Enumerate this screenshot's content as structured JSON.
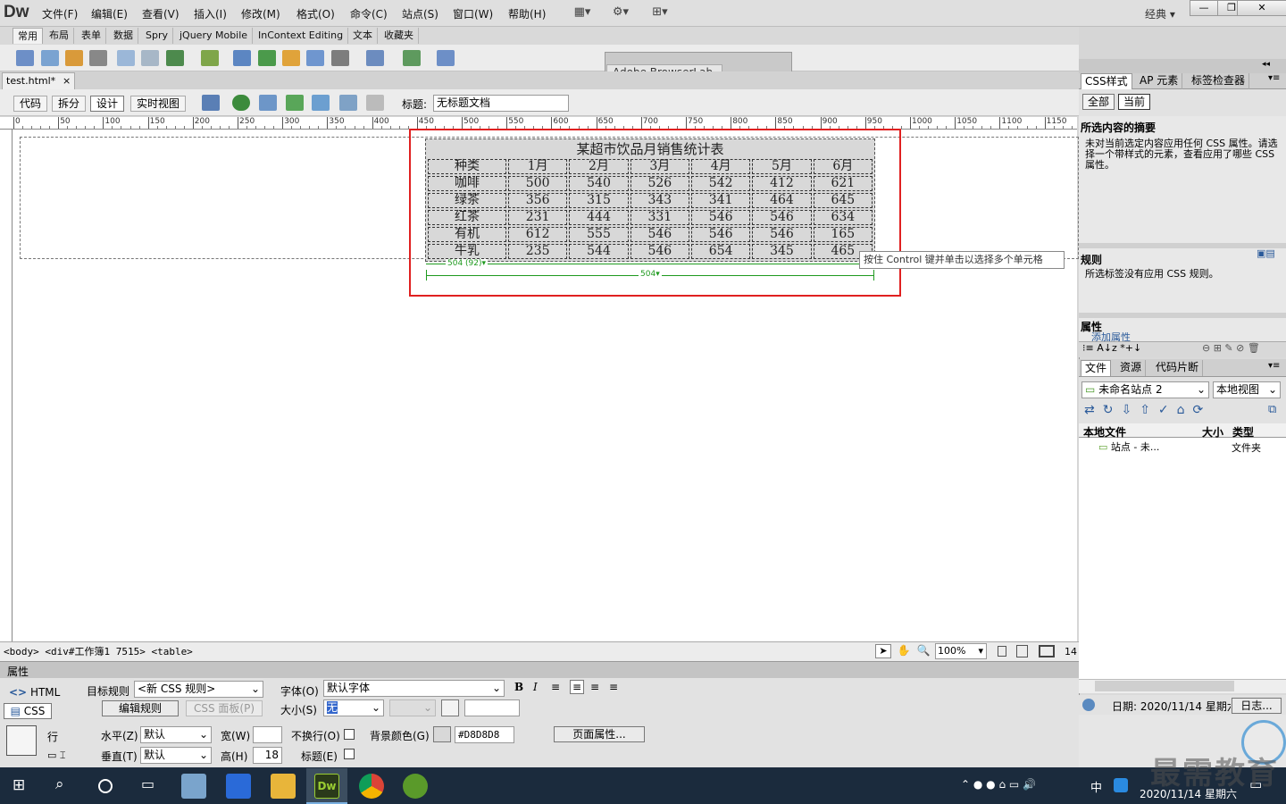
{
  "app": {
    "logo": "Dw",
    "layout_mode": "经典"
  },
  "menu": [
    "文件(F)",
    "编辑(E)",
    "查看(V)",
    "插入(I)",
    "修改(M)",
    "格式(O)",
    "命令(C)",
    "站点(S)",
    "窗口(W)",
    "帮助(H)"
  ],
  "insert_tabs": [
    "常用",
    "布局",
    "表单",
    "数据",
    "Spry",
    "jQuery Mobile",
    "InContext Editing",
    "文本",
    "收藏夹"
  ],
  "floating_panel": {
    "title": "Adobe BrowserLab"
  },
  "document": {
    "tab": "test.html*",
    "close": "×"
  },
  "view_buttons": [
    "代码",
    "拆分",
    "设计",
    "实时视图"
  ],
  "title_label": "标题:",
  "title_value": "无标题文档",
  "ruler": [
    "0",
    "50",
    "100",
    "150",
    "200",
    "250",
    "300",
    "350",
    "400",
    "450",
    "500",
    "550",
    "600",
    "650",
    "700",
    "750",
    "800",
    "850",
    "900",
    "950",
    "1000",
    "1050",
    "1100",
    "1150"
  ],
  "table": {
    "caption": "某超市饮品月销售统计表",
    "header": [
      "种类",
      "1月",
      "2月",
      "3月",
      "4月",
      "5月",
      "6月"
    ],
    "rows": [
      [
        "咖啡",
        "500",
        "540",
        "526",
        "542",
        "412",
        "621"
      ],
      [
        "绿茶",
        "356",
        "315",
        "343",
        "341",
        "464",
        "645"
      ],
      [
        "红茶",
        "231",
        "444",
        "331",
        "546",
        "546",
        "634"
      ],
      [
        "有机",
        "612",
        "555",
        "546",
        "546",
        "546",
        "165"
      ],
      [
        "牛乳",
        "235",
        "544",
        "546",
        "654",
        "345",
        "465"
      ]
    ],
    "width_label_1": "504 (92)",
    "width_label_2": "504"
  },
  "tooltip": "按住 Control 键并单击以选择多个单元格",
  "status": {
    "tagpath": "<body> <div#工作簿1 7515> <table>",
    "zoom": "100%",
    "extra": "14"
  },
  "properties": {
    "title": "属性",
    "html_label": "HTML",
    "css_label": "CSS",
    "target_rule_label": "目标规则",
    "target_rule_value": "<新 CSS 规则>",
    "edit_rule": "编辑规则",
    "css_panel": "CSS 面板(P)",
    "font_label": "字体(O)",
    "font_value": "默认字体",
    "size_label": "大小(S)",
    "size_value": "无",
    "row_label": "行",
    "horiz_label": "水平(Z)",
    "horiz_value": "默认",
    "vert_label": "垂直(T)",
    "vert_value": "默认",
    "width_label": "宽(W)",
    "height_label": "高(H)",
    "height_value": "18",
    "nowrap_label": "不换行(O)",
    "header_label": "标题(E)",
    "bg_label": "背景颜色(G)",
    "bg_value": "#D8D8D8",
    "page_props": "页面属性..."
  },
  "css_panel": {
    "tabs": [
      "CSS样式",
      "AP 元素",
      "标签检查器"
    ],
    "mode_tabs": [
      "全部",
      "当前"
    ],
    "summary_title": "所选内容的摘要",
    "summary_text": "未对当前选定内容应用任何 CSS 属性。请选择一个带样式的元素，查看应用了哪些 CSS 属性。",
    "rules_title": "规则",
    "rules_text": "所选标签没有应用 CSS 规则。",
    "props_title": "属性",
    "add_prop": "添加属性"
  },
  "files_panel": {
    "tabs": [
      "文件",
      "资源",
      "代码片断"
    ],
    "site": "未命名站点 2",
    "view": "本地视图",
    "cols": [
      "本地文件",
      "大小",
      "类型"
    ],
    "row": {
      "name": "站点 - 未...",
      "type": "文件夹"
    },
    "date": "日期: 2020/11/14 星期六",
    "log": "日志..."
  },
  "taskbar": {
    "ime": "中",
    "time": "",
    "date": "2020/11/14 星期六"
  },
  "watermark": "最需教育"
}
